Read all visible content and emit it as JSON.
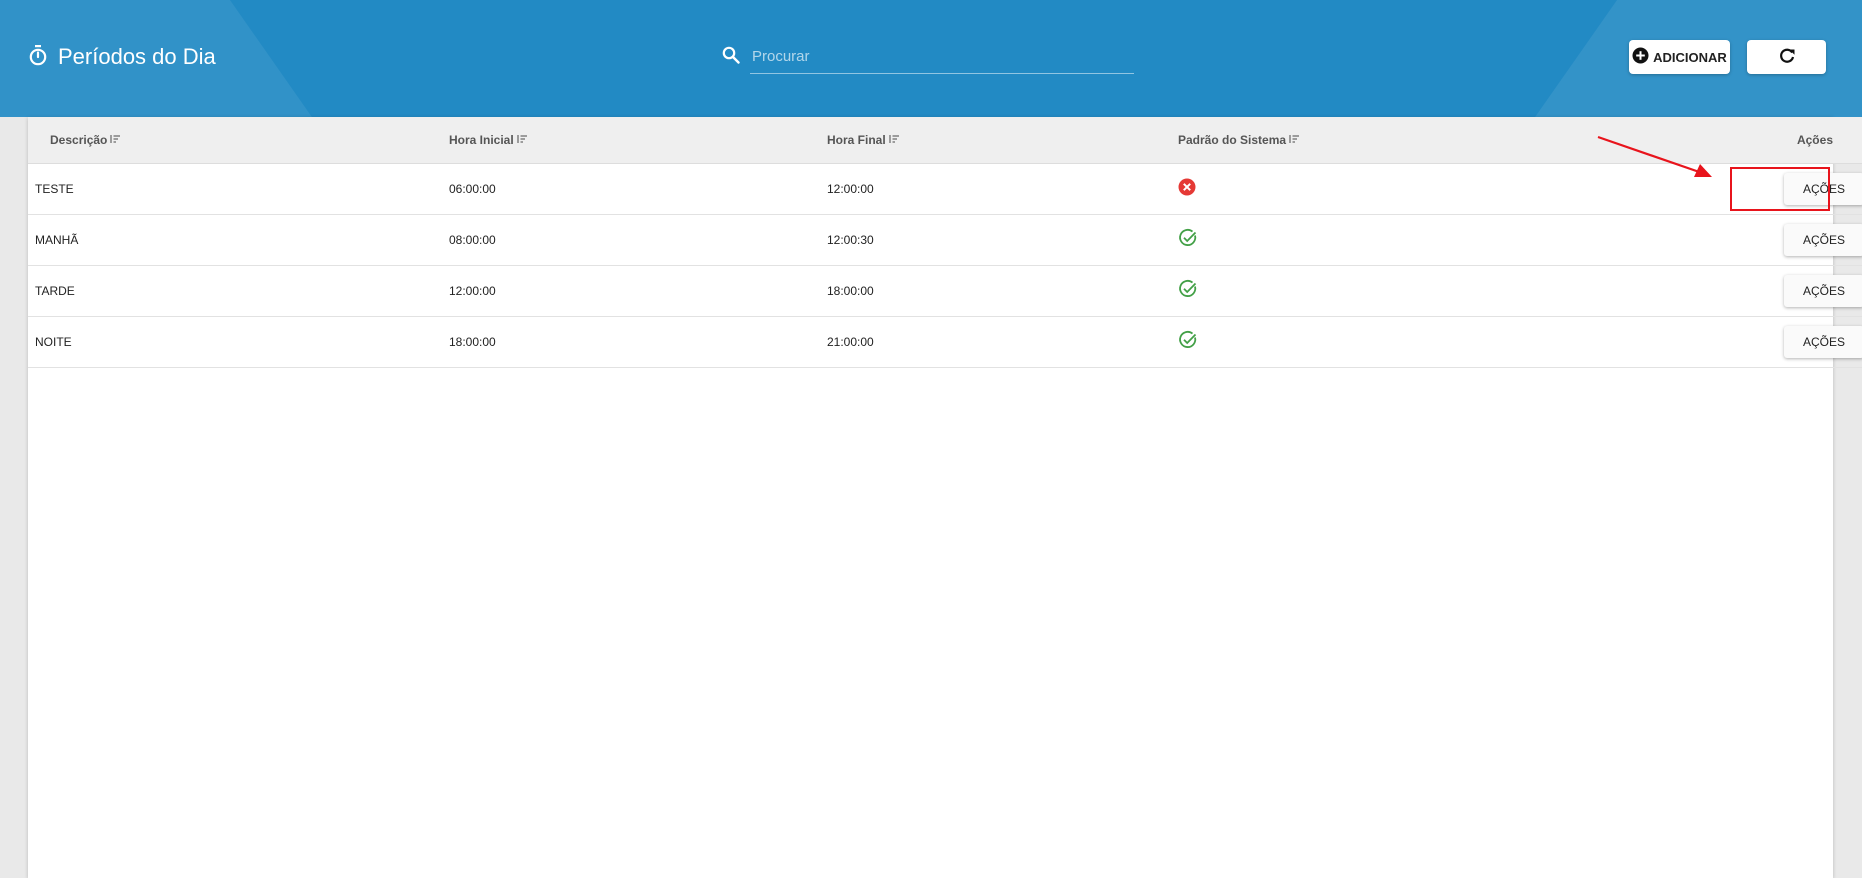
{
  "header": {
    "title": "Períodos do Dia",
    "title_icon": "timer-icon",
    "search": {
      "placeholder": "Procurar",
      "value": "",
      "icon": "search-icon"
    },
    "add_button": {
      "label": "ADICIONAR",
      "icon": "plus-circle-icon"
    },
    "refresh_button": {
      "icon": "refresh-icon"
    }
  },
  "table": {
    "columns": [
      {
        "label": "Descrição",
        "sortable": true
      },
      {
        "label": "Hora Inicial",
        "sortable": true
      },
      {
        "label": "Hora Final",
        "sortable": true
      },
      {
        "label": "Padrão do Sistema",
        "sortable": true
      },
      {
        "label": "Ações",
        "sortable": false
      }
    ],
    "rows": [
      {
        "descricao": "TESTE",
        "hora_inicial": "06:00:00",
        "hora_final": "12:00:00",
        "padrao": false,
        "acoes_label": "AÇÕES"
      },
      {
        "descricao": "MANHÃ",
        "hora_inicial": "08:00:00",
        "hora_final": "12:00:30",
        "padrao": true,
        "acoes_label": "AÇÕES"
      },
      {
        "descricao": "TARDE",
        "hora_inicial": "12:00:00",
        "hora_final": "18:00:00",
        "padrao": true,
        "acoes_label": "AÇÕES"
      },
      {
        "descricao": "NOITE",
        "hora_inicial": "18:00:00",
        "hora_final": "21:00:00",
        "padrao": true,
        "acoes_label": "AÇÕES"
      }
    ]
  },
  "colors": {
    "header_bg": "#228ac4",
    "status_no": "#e53935",
    "status_yes": "#43a047",
    "annotation": "#e8141c"
  },
  "annotation": {
    "highlighted_row": 0,
    "target": "acoes-button"
  }
}
